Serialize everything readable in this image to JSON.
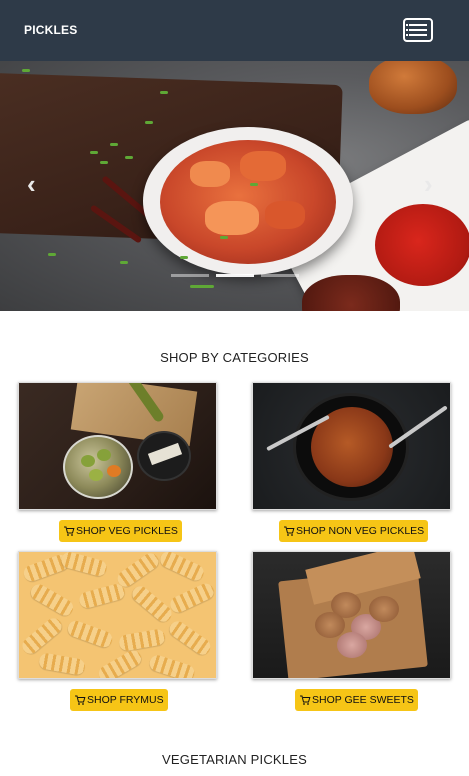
{
  "header": {
    "brand": "PICKLES",
    "menu_icon": "hamburger-menu-icon"
  },
  "carousel": {
    "prev_icon": "chevron-left-icon",
    "next_icon": "chevron-right-icon",
    "slide_count": 3,
    "active_slide": 2
  },
  "categories": {
    "title": "SHOP BY CATEGORIES",
    "items": [
      {
        "label": "SHOP VEG PICKLES",
        "icon": "cart-icon"
      },
      {
        "label": "SHOP NON VEG PICKLES",
        "icon": "cart-icon"
      },
      {
        "label": "SHOP FRYMUS",
        "icon": "cart-icon"
      },
      {
        "label": "SHOP GEE SWEETS",
        "icon": "cart-icon"
      }
    ]
  },
  "vegetarian": {
    "title": "VEGETARIAN PICKLES"
  },
  "colors": {
    "navbar": "#2e3a48",
    "button": "#f6c516"
  }
}
